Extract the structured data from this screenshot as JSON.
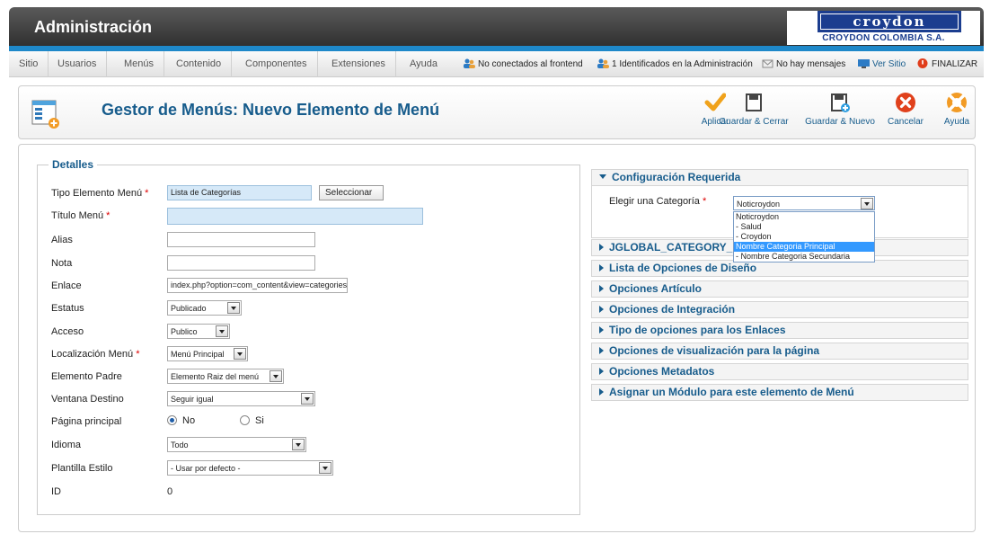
{
  "header": {
    "title": "Administración",
    "brand_main": "croydon",
    "brand_sub": "CROYDON COLOMBIA S.A."
  },
  "menu": [
    "Sitio",
    "Usuarios",
    "Menús",
    "Contenido",
    "Componentes",
    "Extensiones",
    "Ayuda"
  ],
  "status": {
    "frontend": "No conectados al frontend",
    "admin": "1 Identificados en la Administración",
    "messages": "No hay mensajes",
    "view_site": "Ver Sitio",
    "logout": "FINALIZAR"
  },
  "toolbar": {
    "title": "Gestor de Menús: Nuevo Elemento de Menú",
    "apply": "Aplicar",
    "save_close": "Guardar & Cerrar",
    "save_new": "Guardar & Nuevo",
    "cancel": "Cancelar",
    "help": "Ayuda"
  },
  "form": {
    "legend": "Detalles",
    "type_label": "Tipo Elemento Menú",
    "type_value": "Lista de Categorías",
    "type_button": "Seleccionar",
    "title_label": "Título Menú",
    "title_value": "",
    "alias_label": "Alias",
    "note_label": "Nota",
    "link_label": "Enlace",
    "link_value": "index.php?option=com_content&view=categories",
    "status_label": "Estatus",
    "status_value": "Publicado",
    "access_label": "Acceso",
    "access_value": "Publico",
    "location_label": "Localización Menú",
    "location_value": "Menú Principal",
    "parent_label": "Elemento Padre",
    "parent_value": "Elemento Raiz del menú",
    "target_label": "Ventana Destino",
    "target_value": "Seguir igual",
    "home_label": "Página principal",
    "home_no": "No",
    "home_yes": "Si",
    "home_selected": "No",
    "language_label": "Idioma",
    "language_value": "Todo",
    "template_label": "Plantilla Estilo",
    "template_value": "- Usar por defecto -",
    "id_label": "ID",
    "id_value": "0"
  },
  "panels": {
    "required": "Configuración Requerida",
    "category_label": "Elegir una Categoría",
    "category_value": "Noticroydon",
    "category_options": [
      "Noticroydon",
      "- Salud",
      "- Croydon",
      "Nombre Categoria Principal",
      "- Nombre Categoria Secundaria"
    ],
    "category_highlighted": "Nombre Categoria Principal",
    "list": [
      "JGLOBAL_CATEGORY_",
      "Lista de Opciones de Diseño",
      "Opciones Artículo",
      "Opciones de Integración",
      "Tipo de opciones para los Enlaces",
      "Opciones de visualización para la página",
      "Opciones Metadatos",
      "Asignar un Módulo para este elemento de Menú"
    ]
  },
  "colors": {
    "accent": "#175c8c",
    "header": "#3a3a3a",
    "blue_bar": "#1e88c9",
    "required": "#dd0000"
  }
}
